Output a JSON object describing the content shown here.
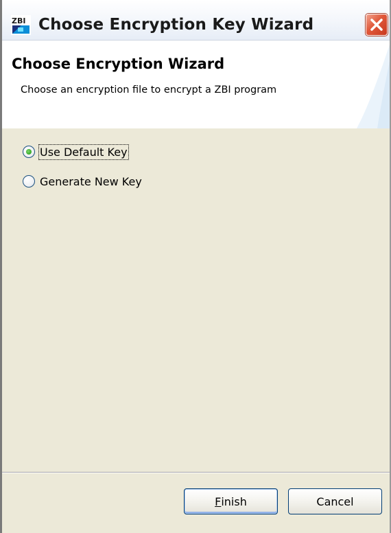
{
  "window": {
    "title": "Choose Encryption Key Wizard",
    "icon_text": "ZBI",
    "icon": "zbi-app-icon",
    "close_icon": "close-x-icon"
  },
  "wizard": {
    "title": "Choose Encryption Wizard",
    "description": "Choose an encryption file to encrypt a ZBI program"
  },
  "options": [
    {
      "label": "Use Default Key",
      "checked": true
    },
    {
      "label": "Generate New Key",
      "checked": false
    }
  ],
  "buttons": {
    "finish_mnemonic": "F",
    "finish_rest": "inish",
    "cancel": "Cancel"
  },
  "colors": {
    "close_button": "#e0583a",
    "radio_selected": "#34a826",
    "dialog_bg": "#ece9d8"
  }
}
